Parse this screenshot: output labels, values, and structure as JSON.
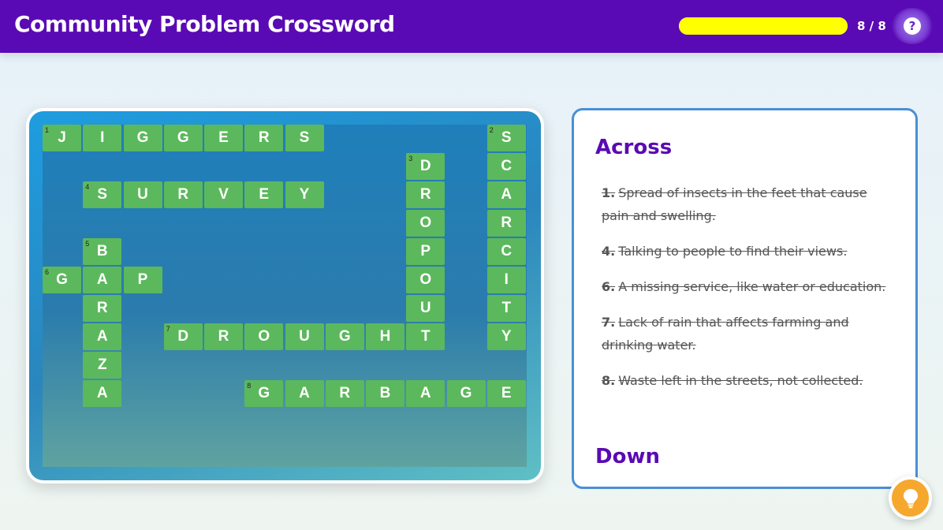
{
  "header": {
    "title": "Community Problem Crossword",
    "progress_text": "8 / 8",
    "progress_fraction": 1.0,
    "help_label": "?"
  },
  "colors": {
    "header_bg": "#5a0ab4",
    "cell_green": "#5cb85c",
    "progress_fill": "#ffff00",
    "panel_border": "#4a8fd6",
    "hint_button": "#f6a72e"
  },
  "grid": {
    "rows": 10,
    "cols": 12,
    "cells": [
      {
        "r": 0,
        "c": 0,
        "ch": "J",
        "num": "1"
      },
      {
        "r": 0,
        "c": 1,
        "ch": "I"
      },
      {
        "r": 0,
        "c": 2,
        "ch": "G"
      },
      {
        "r": 0,
        "c": 3,
        "ch": "G"
      },
      {
        "r": 0,
        "c": 4,
        "ch": "E"
      },
      {
        "r": 0,
        "c": 5,
        "ch": "R"
      },
      {
        "r": 0,
        "c": 6,
        "ch": "S"
      },
      {
        "r": 0,
        "c": 11,
        "ch": "S",
        "num": "2"
      },
      {
        "r": 1,
        "c": 9,
        "ch": "D",
        "num": "3"
      },
      {
        "r": 1,
        "c": 11,
        "ch": "C"
      },
      {
        "r": 2,
        "c": 1,
        "ch": "S",
        "num": "4"
      },
      {
        "r": 2,
        "c": 2,
        "ch": "U"
      },
      {
        "r": 2,
        "c": 3,
        "ch": "R"
      },
      {
        "r": 2,
        "c": 4,
        "ch": "V"
      },
      {
        "r": 2,
        "c": 5,
        "ch": "E"
      },
      {
        "r": 2,
        "c": 6,
        "ch": "Y"
      },
      {
        "r": 2,
        "c": 9,
        "ch": "R"
      },
      {
        "r": 2,
        "c": 11,
        "ch": "A"
      },
      {
        "r": 3,
        "c": 9,
        "ch": "O"
      },
      {
        "r": 3,
        "c": 11,
        "ch": "R"
      },
      {
        "r": 4,
        "c": 1,
        "ch": "B",
        "num": "5"
      },
      {
        "r": 4,
        "c": 9,
        "ch": "P"
      },
      {
        "r": 4,
        "c": 11,
        "ch": "C"
      },
      {
        "r": 5,
        "c": 0,
        "ch": "G",
        "num": "6"
      },
      {
        "r": 5,
        "c": 1,
        "ch": "A"
      },
      {
        "r": 5,
        "c": 2,
        "ch": "P"
      },
      {
        "r": 5,
        "c": 9,
        "ch": "O"
      },
      {
        "r": 5,
        "c": 11,
        "ch": "I"
      },
      {
        "r": 6,
        "c": 1,
        "ch": "R"
      },
      {
        "r": 6,
        "c": 9,
        "ch": "U"
      },
      {
        "r": 6,
        "c": 11,
        "ch": "T"
      },
      {
        "r": 7,
        "c": 1,
        "ch": "A"
      },
      {
        "r": 7,
        "c": 3,
        "ch": "D",
        "num": "7"
      },
      {
        "r": 7,
        "c": 4,
        "ch": "R"
      },
      {
        "r": 7,
        "c": 5,
        "ch": "O"
      },
      {
        "r": 7,
        "c": 6,
        "ch": "U"
      },
      {
        "r": 7,
        "c": 7,
        "ch": "G"
      },
      {
        "r": 7,
        "c": 8,
        "ch": "H"
      },
      {
        "r": 7,
        "c": 9,
        "ch": "T"
      },
      {
        "r": 7,
        "c": 11,
        "ch": "Y"
      },
      {
        "r": 8,
        "c": 1,
        "ch": "Z"
      },
      {
        "r": 9,
        "c": 1,
        "ch": "A"
      },
      {
        "r": 9,
        "c": 5,
        "ch": "G",
        "num": "8"
      },
      {
        "r": 9,
        "c": 6,
        "ch": "A"
      },
      {
        "r": 9,
        "c": 7,
        "ch": "R"
      },
      {
        "r": 9,
        "c": 8,
        "ch": "B"
      },
      {
        "r": 9,
        "c": 9,
        "ch": "A"
      },
      {
        "r": 9,
        "c": 10,
        "ch": "G"
      },
      {
        "r": 9,
        "c": 11,
        "ch": "E"
      }
    ]
  },
  "clues": {
    "across_heading": "Across",
    "down_heading": "Down",
    "across": [
      {
        "num": "1.",
        "text": "Spread of insects in the feet that cause pain and swelling.",
        "solved": true
      },
      {
        "num": "4.",
        "text": "Talking to people to find their views.",
        "solved": true
      },
      {
        "num": "6.",
        "text": "A missing service, like water or education.",
        "solved": true
      },
      {
        "num": "7.",
        "text": "Lack of rain that affects farming and drinking water.",
        "solved": true
      },
      {
        "num": "8.",
        "text": "Waste left in the streets, not collected.",
        "solved": true
      }
    ]
  },
  "icons": {
    "help": "question-icon",
    "hint": "lightbulb-icon"
  }
}
